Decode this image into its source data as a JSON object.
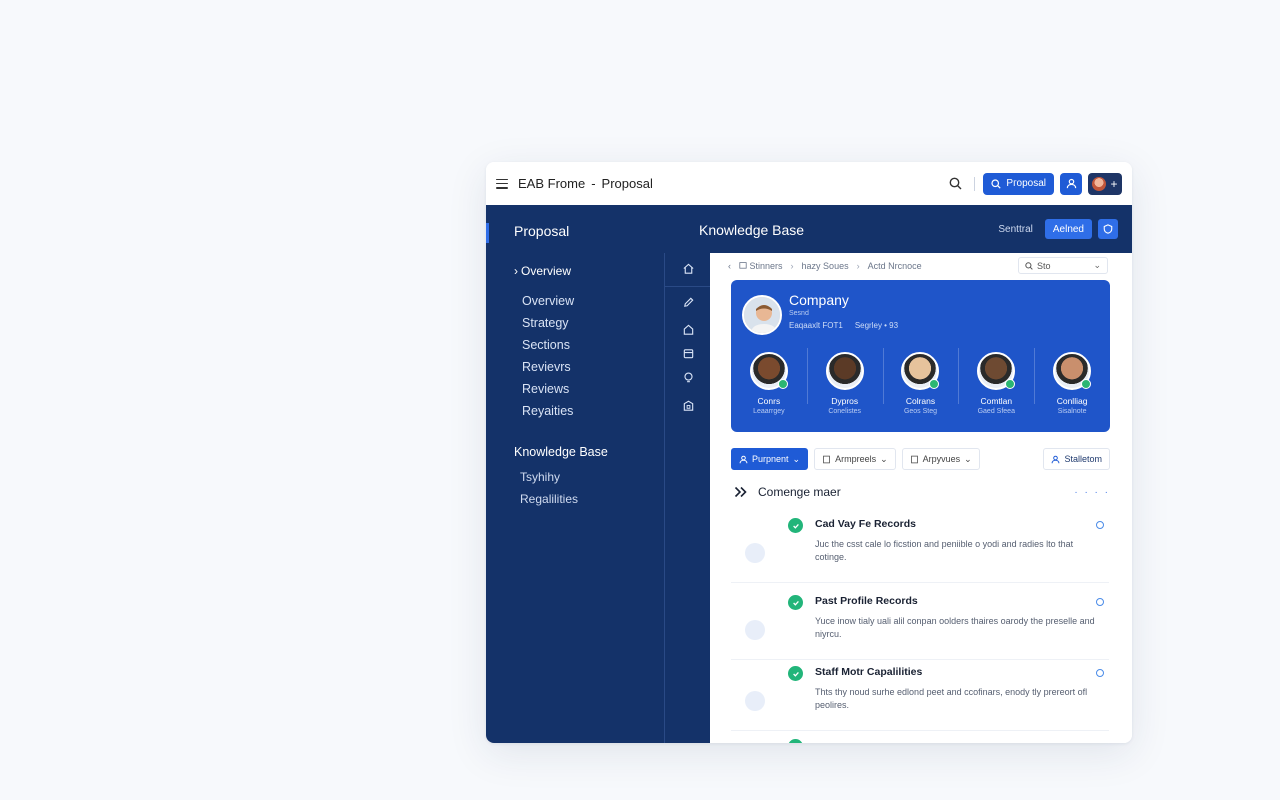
{
  "titlebar": {
    "app_name": "EAB Frome",
    "separator": "-",
    "section": "Proposal",
    "primary_button": "Ргороsаl"
  },
  "sidebar": {
    "title": "Proposal",
    "overview_toggle": "Overview",
    "items": [
      {
        "label": "Overview"
      },
      {
        "label": "Strategy"
      },
      {
        "label": "Sections"
      },
      {
        "label": "Revievrs"
      },
      {
        "label": "Reviews"
      },
      {
        "label": "Reyaities"
      }
    ],
    "kb_title": "Knowledge Base",
    "kb_items": [
      {
        "label": "Tsyhihy"
      },
      {
        "label": "Regalilities"
      }
    ]
  },
  "main_header": {
    "title": "Knowledge Base",
    "label": "Senttral",
    "button": "Aelned"
  },
  "breadcrumb": {
    "items": [
      "Stinners",
      "hazy Soues",
      "Actd Nrсnoce"
    ],
    "select_value": "Sto"
  },
  "hero": {
    "name": "Company",
    "subtitle": "Sesnd",
    "meta_left": "Eaqaaxlt FOT1",
    "meta_right": "Segrley • 93",
    "team": [
      {
        "name": "Conrs",
        "role": "Leaarrgey",
        "skin": "#7a4a2e",
        "verified": true
      },
      {
        "name": "Dypros",
        "role": "Conelistes",
        "skin": "#5b3a26",
        "verified": false
      },
      {
        "name": "Colrans",
        "role": "Geos Steg",
        "skin": "#e6c39c",
        "verified": true
      },
      {
        "name": "Comtlan",
        "role": "Gaed Sfeea",
        "skin": "#6e4a32",
        "verified": true
      },
      {
        "name": "Conlliag",
        "role": "Sisalnote",
        "skin": "#c98f6d",
        "verified": true
      }
    ]
  },
  "filters": {
    "active": "Purpnent",
    "second": "Armpreels",
    "third": "Arpyvues",
    "right": "Stalletom"
  },
  "section": {
    "title": "Comenge maer",
    "more": "· · · ·"
  },
  "records": [
    {
      "title": "Cad Vay Fe Records",
      "desc": "Juc the csst cale lo ficstion and peniible o yodi and radies lto that cotinge."
    },
    {
      "title": "Past Profile Records",
      "desc": "Yuce inow tialy uali alil conpan oolders thaires oarody the preselle and niyrcu."
    },
    {
      "title": "Staff Motr Capalilities",
      "desc": "Thts thy noud surhe edlond peet and ccofinars, enody tly prereort ofl peolires."
    }
  ],
  "colors": {
    "navy": "#143269",
    "accent": "#1f5bd6",
    "hero": "#1f55c9",
    "success": "#22b57a"
  }
}
